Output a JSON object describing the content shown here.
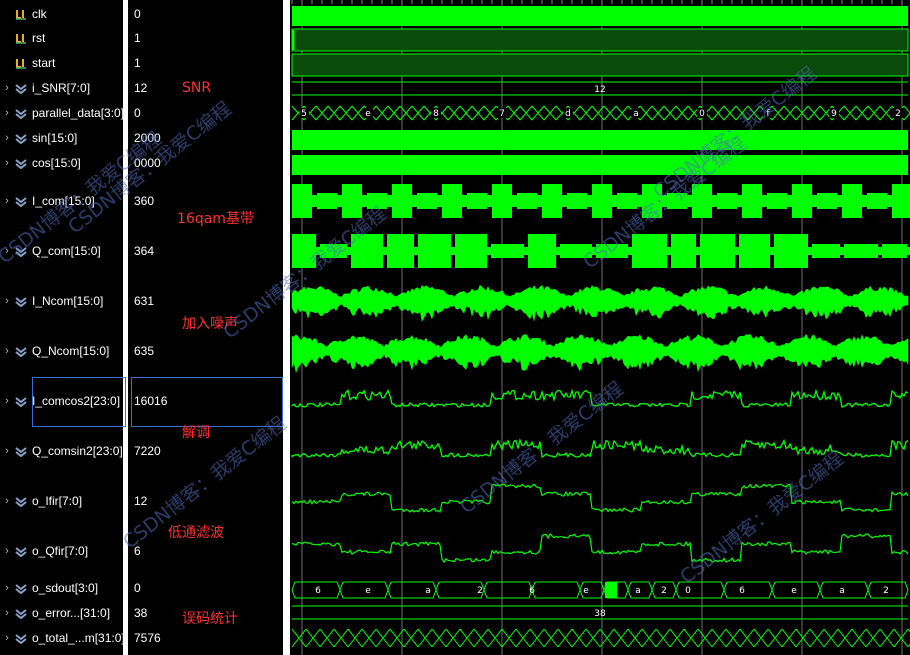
{
  "signals": [
    {
      "name": "clk",
      "value": "0",
      "kind": "bit"
    },
    {
      "name": "rst",
      "value": "1",
      "kind": "bit"
    },
    {
      "name": "start",
      "value": "1",
      "kind": "bit"
    },
    {
      "name": "i_SNR[7:0]",
      "value": "12",
      "kind": "bus"
    },
    {
      "name": "parallel_data[3:0]",
      "value": "0",
      "kind": "bus"
    },
    {
      "name": "sin[15:0]",
      "value": "2000",
      "kind": "bus"
    },
    {
      "name": "cos[15:0]",
      "value": "0000",
      "kind": "bus"
    },
    {
      "name": "I_com[15:0]",
      "value": "360",
      "kind": "bus"
    },
    {
      "name": "Q_com[15:0]",
      "value": "364",
      "kind": "bus"
    },
    {
      "name": "I_Ncom[15:0]",
      "value": "631",
      "kind": "bus"
    },
    {
      "name": "Q_Ncom[15:0]",
      "value": "635",
      "kind": "bus"
    },
    {
      "name": "I_comcos2[23:0]",
      "value": "16016",
      "kind": "bus"
    },
    {
      "name": "Q_comsin2[23:0]",
      "value": "7220",
      "kind": "bus"
    },
    {
      "name": "o_Ifir[7:0]",
      "value": "12",
      "kind": "bus"
    },
    {
      "name": "o_Qfir[7:0]",
      "value": "6",
      "kind": "bus"
    },
    {
      "name": "o_sdout[3:0]",
      "value": "0",
      "kind": "bus"
    },
    {
      "name": "o_error...[31:0]",
      "value": "38",
      "kind": "bus"
    },
    {
      "name": "o_total_...m[31:0]",
      "value": "7576",
      "kind": "bus"
    }
  ],
  "wave_labels": {
    "snr": "12",
    "parallel": [
      "5",
      "e",
      "8",
      "7",
      "d",
      "a",
      "0",
      "f",
      "9",
      "2"
    ],
    "sdout": [
      "6",
      "e",
      "a",
      "2",
      "6",
      "e",
      "a",
      "2",
      "0",
      "6",
      "e",
      "a",
      "2"
    ],
    "error": "38"
  },
  "annotations": {
    "snr": "SNR",
    "baseband": "16qam基带",
    "noise": "加入噪声",
    "demod": "解调",
    "lowpass": "低通滤波",
    "ber": "误码统计"
  },
  "watermark": [
    "CSDN博客：我爱C编程",
    "CSDN博客：我爱C编程",
    "CSDN博客：我爱C编程",
    "CSDN博客：我爱C编程",
    "CSDN博客：我爱C编程",
    "CSDN博客：我爱C编程",
    "CSDN博客：我爱C编程",
    "CSDN博客：我爱C编程"
  ],
  "colors": {
    "wave": "#00ff00",
    "annotation": "#ff3030",
    "icon_bit": "#e8b020",
    "icon_bus": "#8aa4c8"
  }
}
